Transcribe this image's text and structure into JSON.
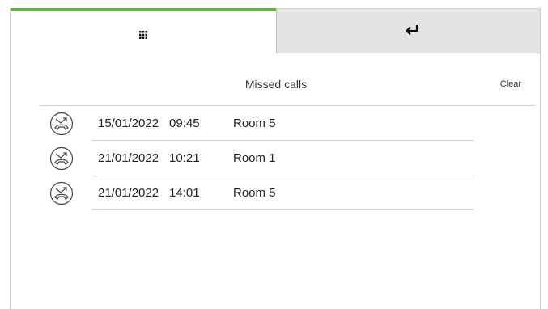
{
  "tabs": {
    "keypad": {
      "icon": "keypad-grid-icon",
      "active": true,
      "accent": "#6ab04c"
    },
    "back": {
      "icon": "return-arrow-icon",
      "active": false
    }
  },
  "header": {
    "title": "Missed calls",
    "clear_label": "Clear"
  },
  "missed_calls": [
    {
      "date": "15/01/2022",
      "time": "09:45",
      "room": "Room 5",
      "icon": "missed-call-icon"
    },
    {
      "date": "21/01/2022",
      "time": "10:21",
      "room": "Room 1",
      "icon": "missed-call-icon"
    },
    {
      "date": "21/01/2022",
      "time": "14:01",
      "room": "Room 5",
      "icon": "missed-call-icon"
    }
  ]
}
